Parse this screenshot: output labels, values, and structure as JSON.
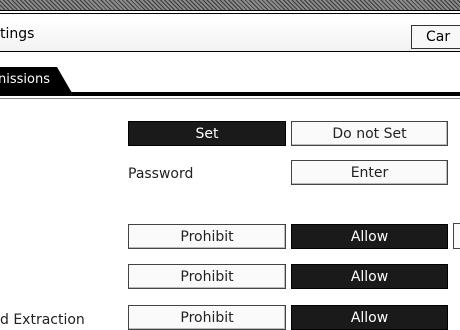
{
  "header": {
    "title": "tings",
    "cancel_label": "Car"
  },
  "tabs": [
    {
      "label": "nissions",
      "active": true
    }
  ],
  "rows": {
    "set_row": {
      "set_label": "Set",
      "do_not_set_label": "Do not Set",
      "selected": "Set"
    },
    "password_row": {
      "label": "Password",
      "enter_label": "Enter"
    },
    "row1": {
      "label": "",
      "prohibit_label": "Prohibit",
      "allow_label": "Allow",
      "selected": "Allow"
    },
    "row2": {
      "label": "",
      "prohibit_label": "Prohibit",
      "allow_label": "Allow",
      "selected": "Allow"
    },
    "row3": {
      "label": "d Extraction",
      "prohibit_label": "Prohibit",
      "allow_label": "Allow",
      "selected": "Allow"
    }
  },
  "colors": {
    "selected_bg": "#1a1a1a",
    "selected_fg": "#ffffff",
    "button_bg": "#fafafa"
  }
}
